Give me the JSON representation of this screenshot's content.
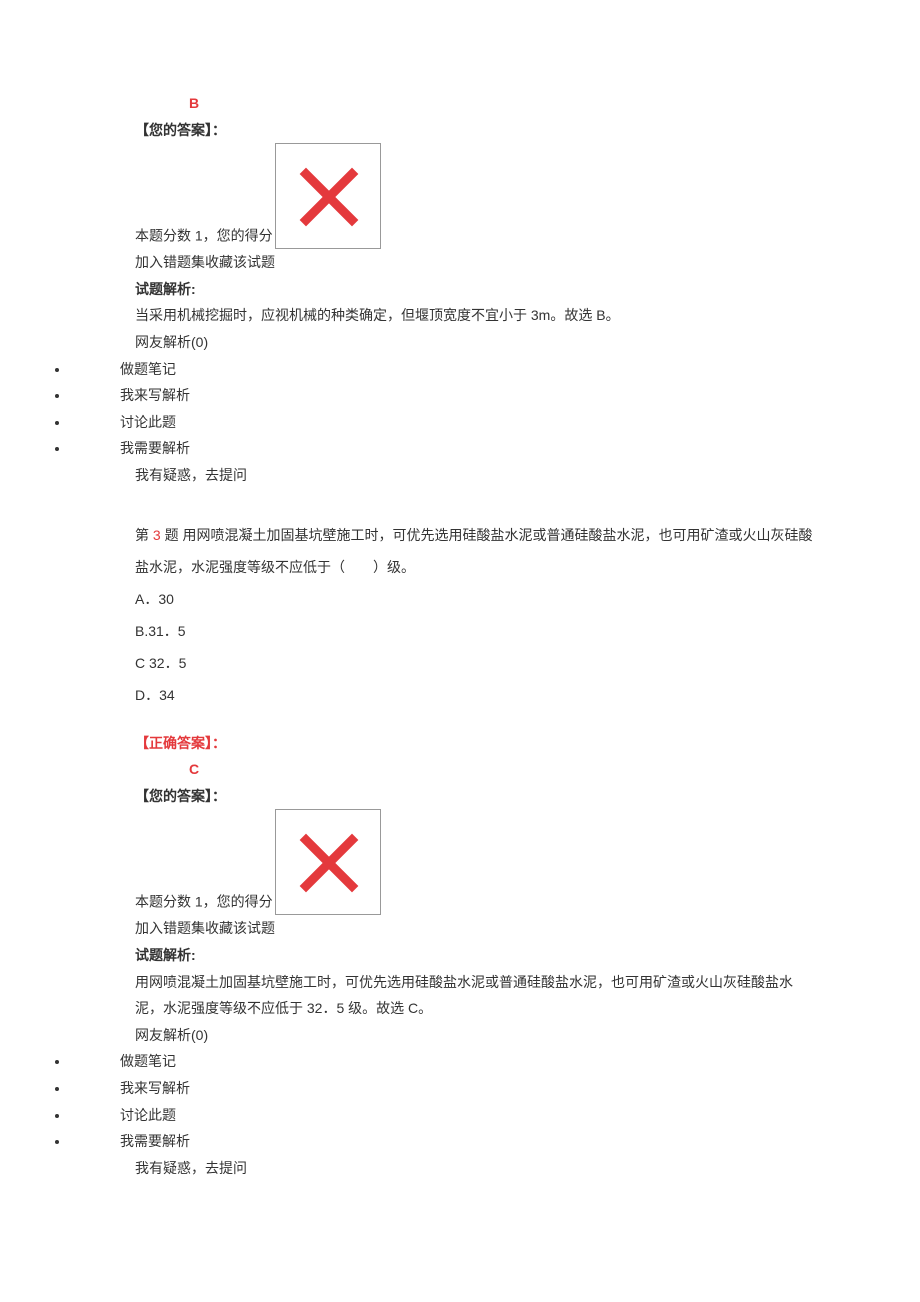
{
  "q2": {
    "answer_letter": "B",
    "your_answer_label": "【您的答案】：",
    "score_prefix": "本题分数 1，您的得分",
    "add_wrong": "加入错题集",
    "favorite": "收藏该试题",
    "analysis_label": "试题解析:",
    "analysis_text": "当采用机械挖掘时，应视机械的种类确定，但堰顶宽度不宜小于 3m。故选 B。",
    "friends_analysis": "网友解析(0)",
    "actions": {
      "note": "做题笔记",
      "write": "我来写解析",
      "discuss": "讨论此题",
      "need": "我需要解析"
    },
    "ask": "我有疑惑，去提问"
  },
  "q3": {
    "prefix": "第 ",
    "num": "3",
    "suffix": " 题",
    "stem": "  用网喷混凝土加固基坑壁施工时，可优先选用硅酸盐水泥或普通硅酸盐水泥，也可用矿渣或火山灰硅酸盐水泥，水泥强度等级不应低于（　　）级。",
    "opt_a": "A．30",
    "opt_b": "B.31．5",
    "opt_c": "C 32．5",
    "opt_d": "D．34",
    "correct_label": "【正确答案】：",
    "answer_letter": "C",
    "your_answer_label": "【您的答案】：",
    "score_prefix": "本题分数 1，您的得分",
    "add_wrong": "加入错题集",
    "favorite": "收藏该试题",
    "analysis_label": "试题解析:",
    "analysis_text": "用网喷混凝土加固基坑壁施工时，可优先选用硅酸盐水泥或普通硅酸盐水泥，也可用矿渣或火山灰硅酸盐水泥，水泥强度等级不应低于 32．5 级。故选 C。",
    "friends_analysis": "网友解析(0)",
    "actions": {
      "note": "做题笔记",
      "write": "我来写解析",
      "discuss": "讨论此题",
      "need": "我需要解析"
    },
    "ask": "我有疑惑，去提问"
  }
}
